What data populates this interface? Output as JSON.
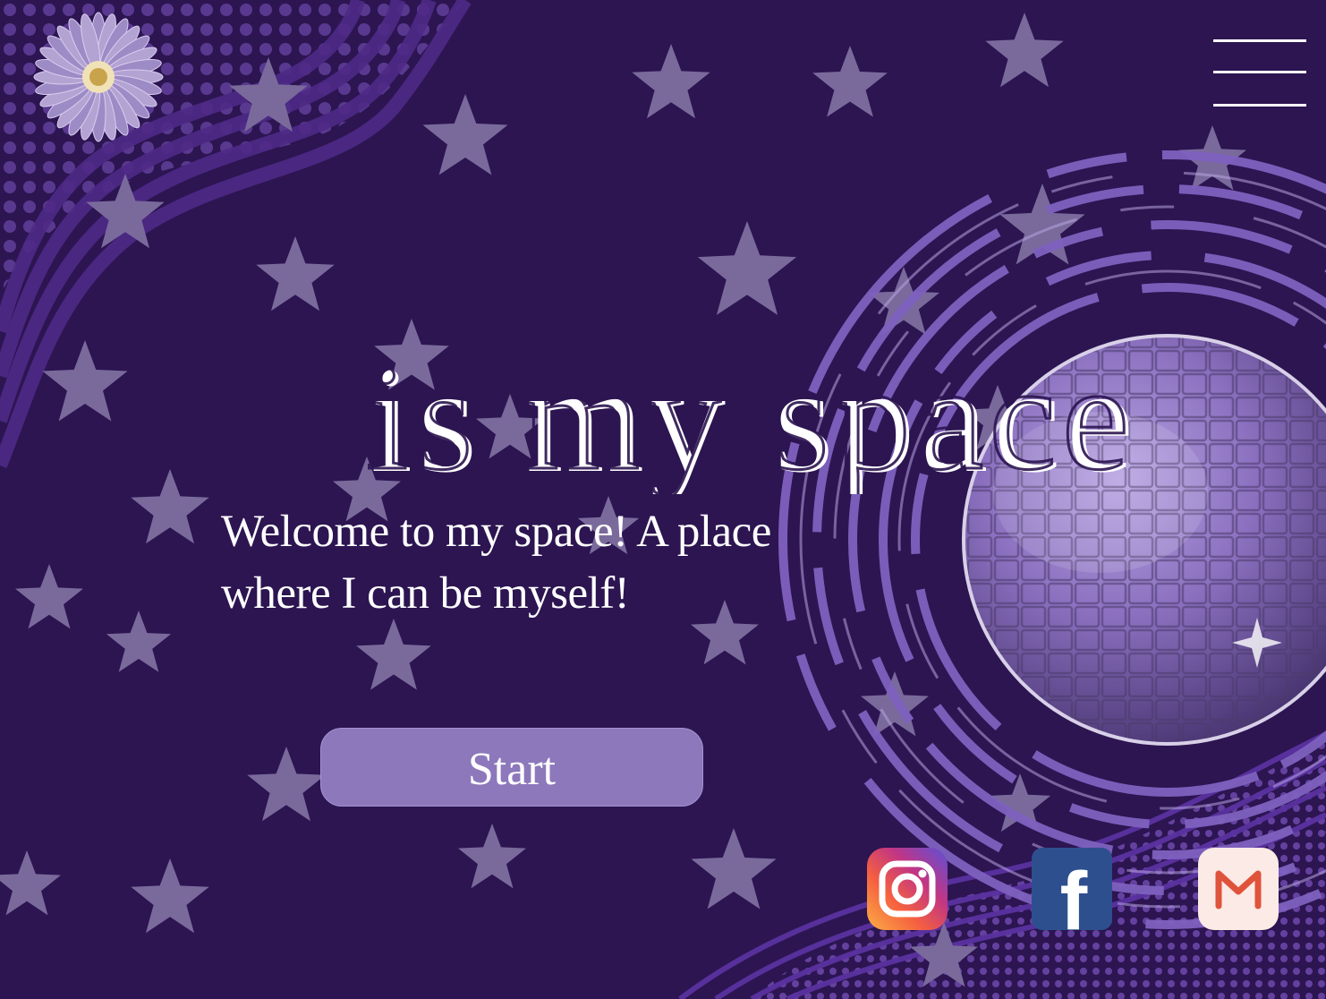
{
  "hero": {
    "title": "is my space",
    "welcome_line1": "Welcome to my space! A place",
    "welcome_line2": "where I can be myself!"
  },
  "actions": {
    "start_label": "Start"
  },
  "nav": {
    "menu_icon": "hamburger-menu-icon"
  },
  "social": [
    {
      "name": "instagram",
      "icon": "instagram-icon"
    },
    {
      "name": "facebook",
      "icon": "facebook-icon",
      "glyph": "f"
    },
    {
      "name": "email",
      "icon": "gmail-icon",
      "glyph": "M"
    }
  ],
  "colors": {
    "background": "#2c1551",
    "star": "#7a6a9c",
    "button": "#8d78bc",
    "ring": "#7f61bf",
    "text": "#ffffff",
    "facebook": "#2d4f8e",
    "gmail_bg": "#fbeae6",
    "gmail_m": "#e0533b"
  }
}
